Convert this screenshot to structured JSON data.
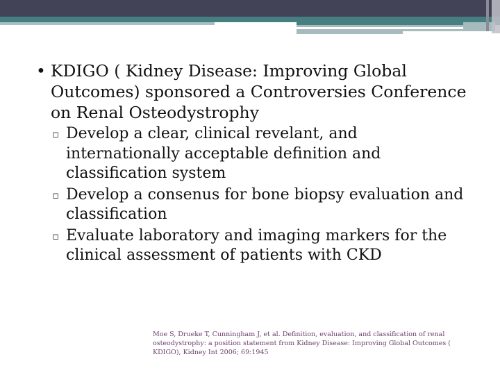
{
  "slide": {
    "bullet": "KDIGO ( Kidney Disease: Improving Global Outcomes) sponsored a Controversies Conference on Renal Osteodystrophy",
    "subbullets": [
      "Develop a clear, clinical revelant, and internationally acceptable definition and classification system",
      "Develop a consenus for bone biopsy evaluation and classification",
      "Evaluate laboratory and imaging markers for the clinical  assessment of patients with CKD"
    ],
    "citation": "Moe S, Drueke T, Cunningham J, et al. Definition, evaluation, and classification of renal osteodystrophy: a position  statement from Kidney Disease: Improving Global Outcomes ( KDIGO), Kidney Int 2006; 69:1945"
  },
  "colors": {
    "header": "#424357",
    "teal": "#477e82",
    "citation": "#6b3e6b"
  }
}
